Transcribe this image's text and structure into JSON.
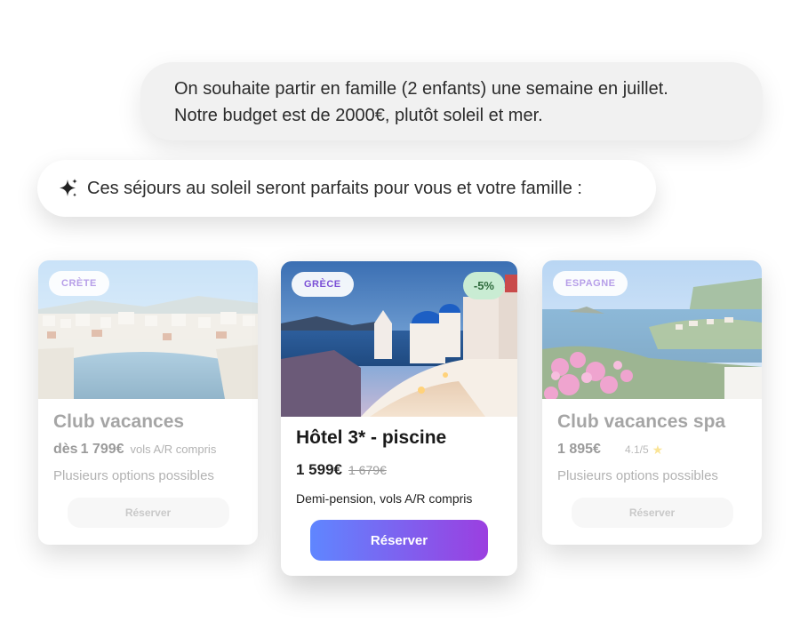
{
  "chat": {
    "user_message_line1": "On souhaite partir en famille (2 enfants) une semaine en juillet.",
    "user_message_line2": "Notre budget est de 2000€, plutôt soleil et mer.",
    "assistant_icon": "sparkle-icon",
    "assistant_message": "Ces séjours au soleil seront parfaits pour vous et votre famille :"
  },
  "offers": [
    {
      "tag": "CRÈTE",
      "title": "Club vacances",
      "price_prefix": "dès",
      "price": "1 799€",
      "price_note": "vols A/R compris",
      "description": "Plusieurs options possibles",
      "button": "Réserver"
    },
    {
      "tag": "GRÈCE",
      "discount": "-5%",
      "title": "Hôtel 3* - piscine",
      "price": "1 599€",
      "old_price": "1 679€",
      "description": "Demi-pension, vols A/R compris",
      "button": "Réserver"
    },
    {
      "tag": "ESPAGNE",
      "title": "Club vacances spa",
      "price": "1 895€",
      "rating": "4.1/5",
      "description": "Plusieurs options possibles",
      "button": "Réserver"
    }
  ],
  "colors": {
    "tag_text": "#7a4fd6",
    "discount_bg": "#c9ecd3",
    "primary_gradient_start": "#5f86ff",
    "primary_gradient_end": "#9b3fe0"
  }
}
